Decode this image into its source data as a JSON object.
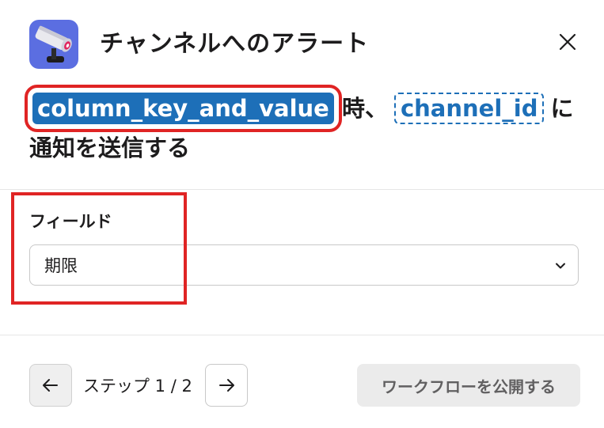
{
  "header": {
    "title": "チャンネルへのアラート",
    "app_icon": "security-camera-icon",
    "close_icon": "close-icon"
  },
  "description": {
    "token_1": "column_key_and_value",
    "text_1": "時、",
    "token_2": "channel_id",
    "text_2": "に通知を送信する"
  },
  "field": {
    "label": "フィールド",
    "selected_value": "期限",
    "chevron_icon": "chevron-down-icon"
  },
  "footer": {
    "prev_icon": "arrow-left-icon",
    "next_icon": "arrow-right-icon",
    "step_text": "ステップ 1 / 2",
    "publish_label": "ワークフローを公開する"
  },
  "colors": {
    "token_blue": "#1d6fb8",
    "highlight_red": "#e02424",
    "app_icon_bg": "#5b6ee1"
  }
}
